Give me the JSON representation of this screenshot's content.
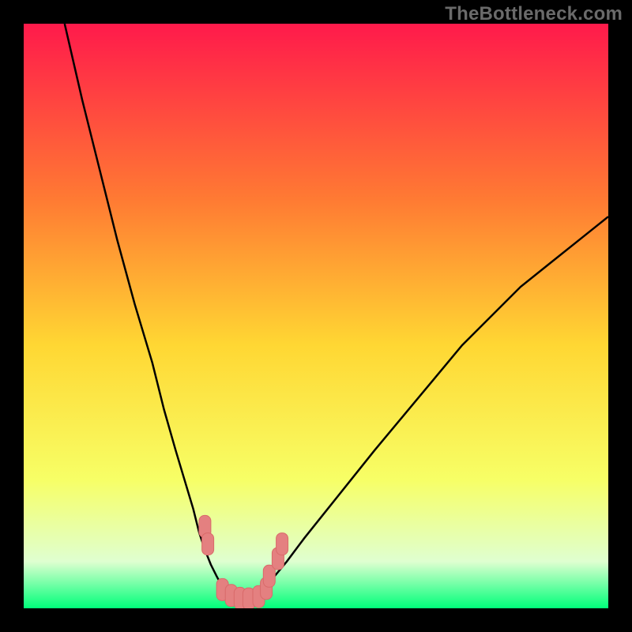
{
  "watermark": "TheBottleneck.com",
  "colors": {
    "frame": "#000000",
    "curve": "#000000",
    "marker_fill": "#e48080",
    "marker_stroke": "#d96a6a",
    "gradient": {
      "top": "#ff1a4b",
      "upper_mid": "#ff7a33",
      "mid": "#ffd733",
      "low": "#f7ff66",
      "lower": "#dfffd0",
      "bottom": "#00ff7a"
    }
  },
  "chart_data": {
    "type": "line",
    "title": "",
    "xlabel": "",
    "ylabel": "",
    "xlim": [
      0,
      100
    ],
    "ylim": [
      0,
      100
    ],
    "series": [
      {
        "name": "left-branch",
        "x": [
          7,
          10,
          13,
          16,
          19,
          22,
          24,
          26,
          27.5,
          29,
          30,
          31,
          32,
          33,
          33.8,
          34.5,
          35
        ],
        "y": [
          100,
          87,
          75,
          63,
          52,
          42,
          34,
          27,
          22,
          17,
          13,
          10,
          7.5,
          5.5,
          4,
          3,
          2.3
        ]
      },
      {
        "name": "valley",
        "x": [
          35,
          36,
          37,
          38,
          39,
          40
        ],
        "y": [
          2.3,
          1.7,
          1.5,
          1.5,
          1.7,
          2.3
        ]
      },
      {
        "name": "right-branch",
        "x": [
          40,
          41,
          42.5,
          45,
          48,
          52,
          56,
          60,
          65,
          70,
          75,
          80,
          85,
          90,
          95,
          100
        ],
        "y": [
          2.3,
          3.2,
          5,
          8,
          12,
          17,
          22,
          27,
          33,
          39,
          45,
          50,
          55,
          59,
          63,
          67
        ]
      }
    ],
    "markers": {
      "name": "highlight-points",
      "shape": "rounded-bar",
      "x": [
        31,
        31.5,
        34,
        35.5,
        37,
        38.5,
        40.2,
        41.5,
        42,
        43.5,
        44.2
      ],
      "y": [
        14,
        11,
        3.2,
        2.2,
        1.7,
        1.6,
        2.0,
        3.4,
        5.5,
        8.5,
        11
      ]
    }
  }
}
